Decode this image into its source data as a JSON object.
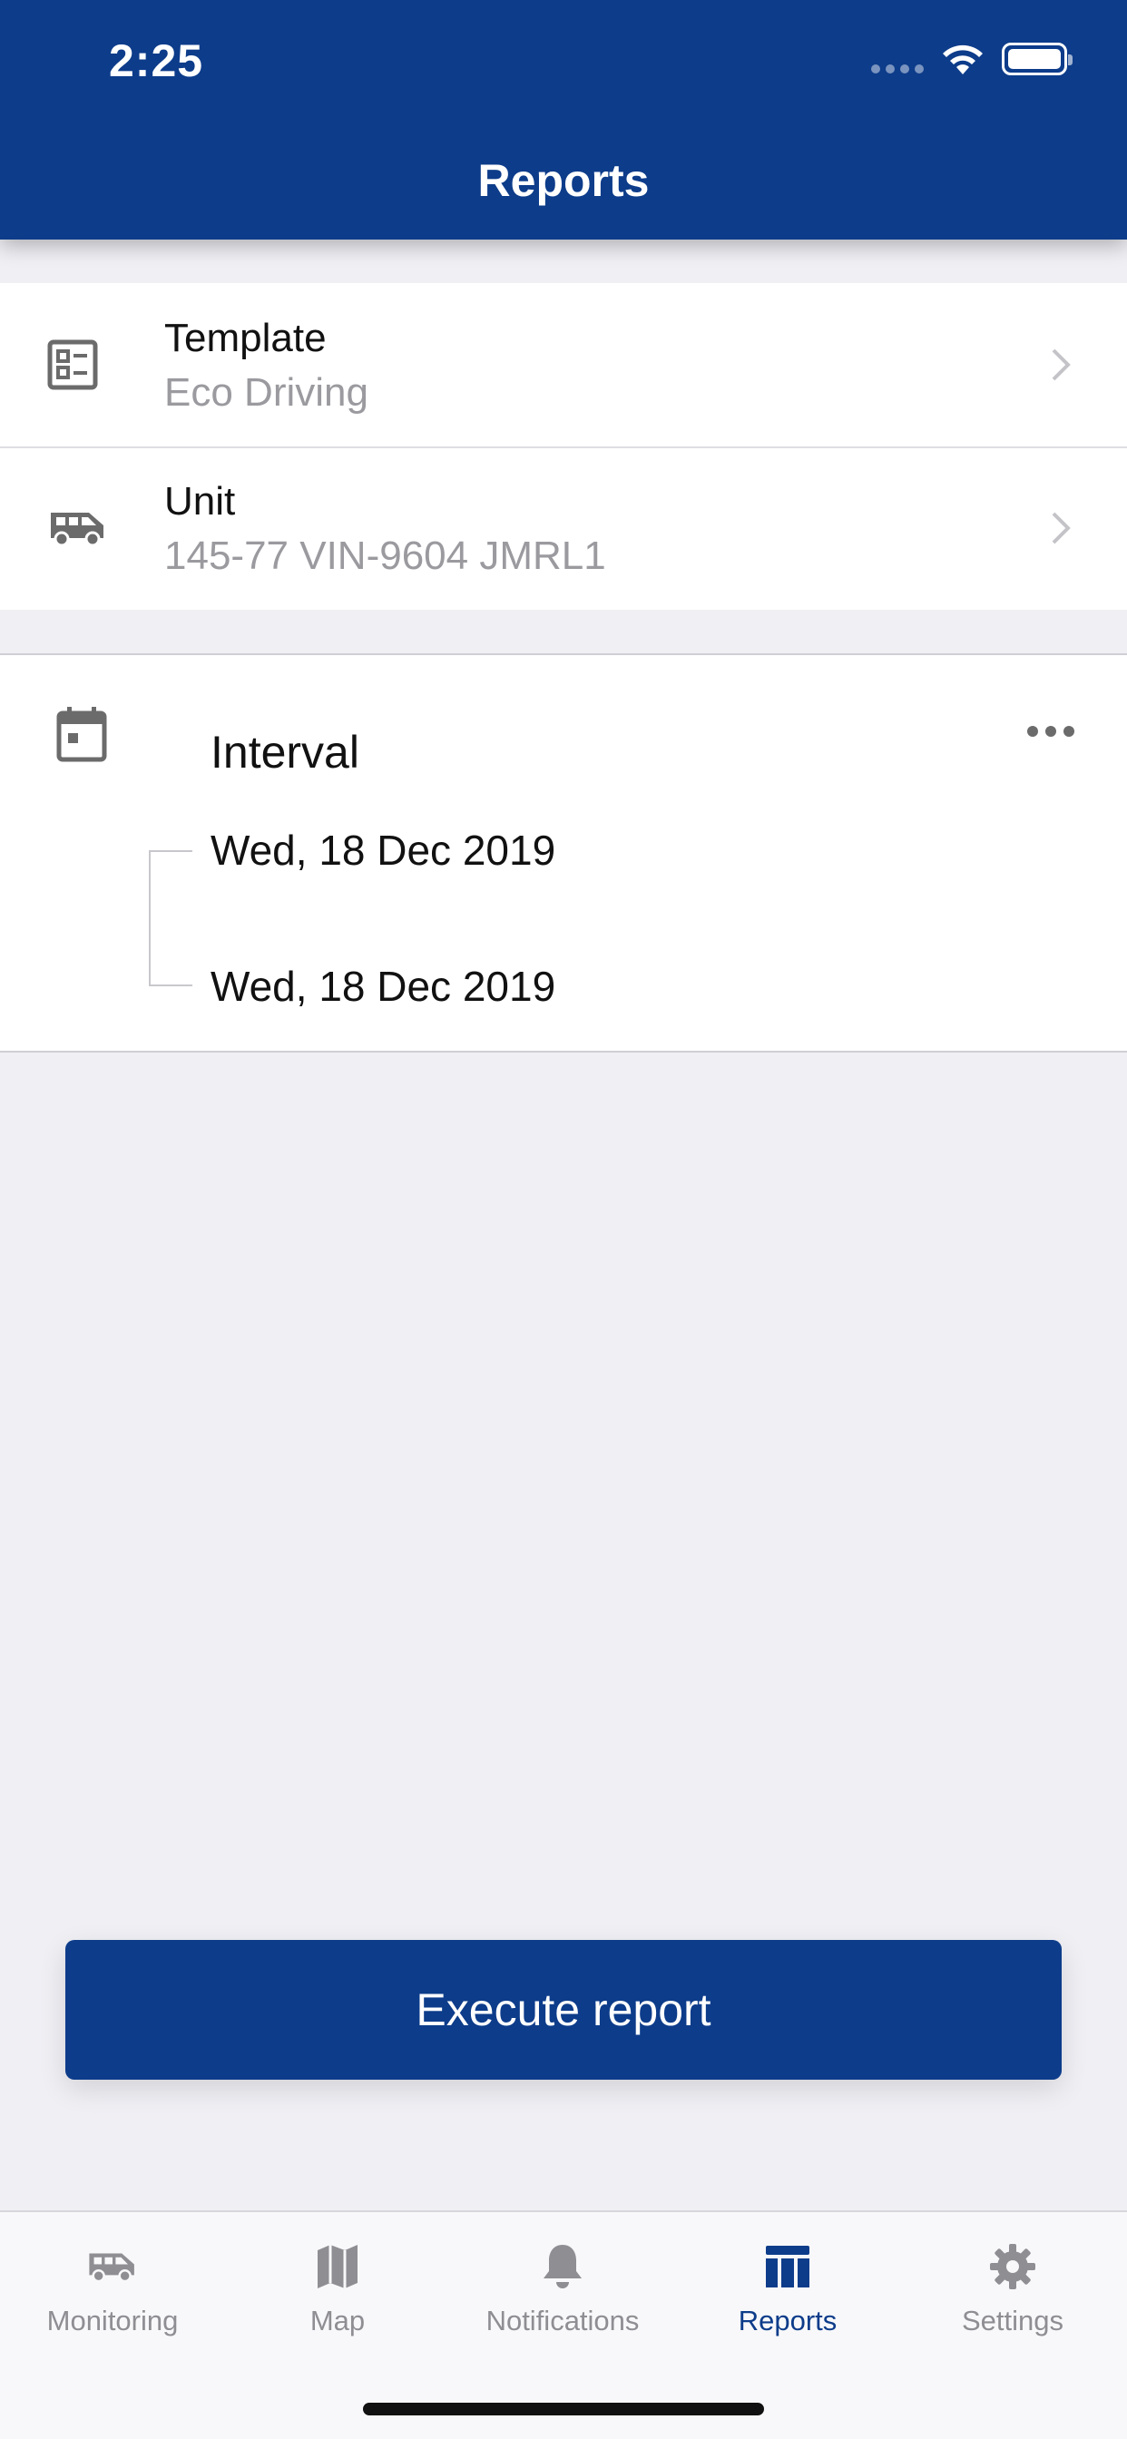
{
  "status_bar": {
    "time": "2:25"
  },
  "header": {
    "title": "Reports"
  },
  "rows": {
    "template": {
      "title": "Template",
      "value": "Eco Driving"
    },
    "unit": {
      "title": "Unit",
      "value": "145-77 VIN-9604  JMRL1"
    }
  },
  "interval": {
    "title": "Interval",
    "from": "Wed, 18 Dec 2019",
    "to": "Wed, 18 Dec 2019"
  },
  "execute_button": {
    "label": "Execute report"
  },
  "tabbar": {
    "active": "Reports",
    "tabs": [
      {
        "label": "Monitoring",
        "icon": "van-icon"
      },
      {
        "label": "Map",
        "icon": "map-icon"
      },
      {
        "label": "Notifications",
        "icon": "bell-icon"
      },
      {
        "label": "Reports",
        "icon": "table-icon"
      },
      {
        "label": "Settings",
        "icon": "gear-icon"
      }
    ]
  },
  "colors": {
    "primary": "#0d3c8a",
    "background": "#efeff4",
    "secondary_text": "#9a9a9f",
    "inactive_tab": "#8e8e93"
  }
}
